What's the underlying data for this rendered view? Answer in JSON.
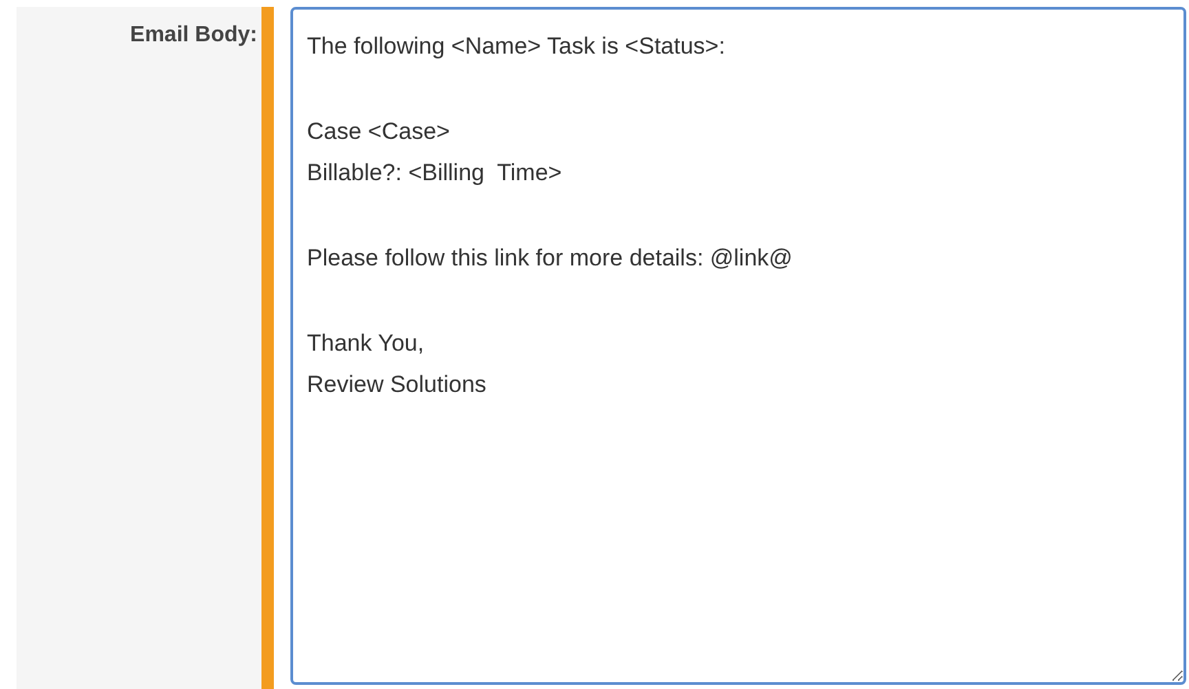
{
  "field": {
    "label": "Email Body:",
    "value": "The following <Name> Task is <Status>:\n\nCase <Case>\nBillable?: <Billing  Time>\n\nPlease follow this link for more details: @link@\n\nThank You,\nReview Solutions",
    "required": true
  }
}
